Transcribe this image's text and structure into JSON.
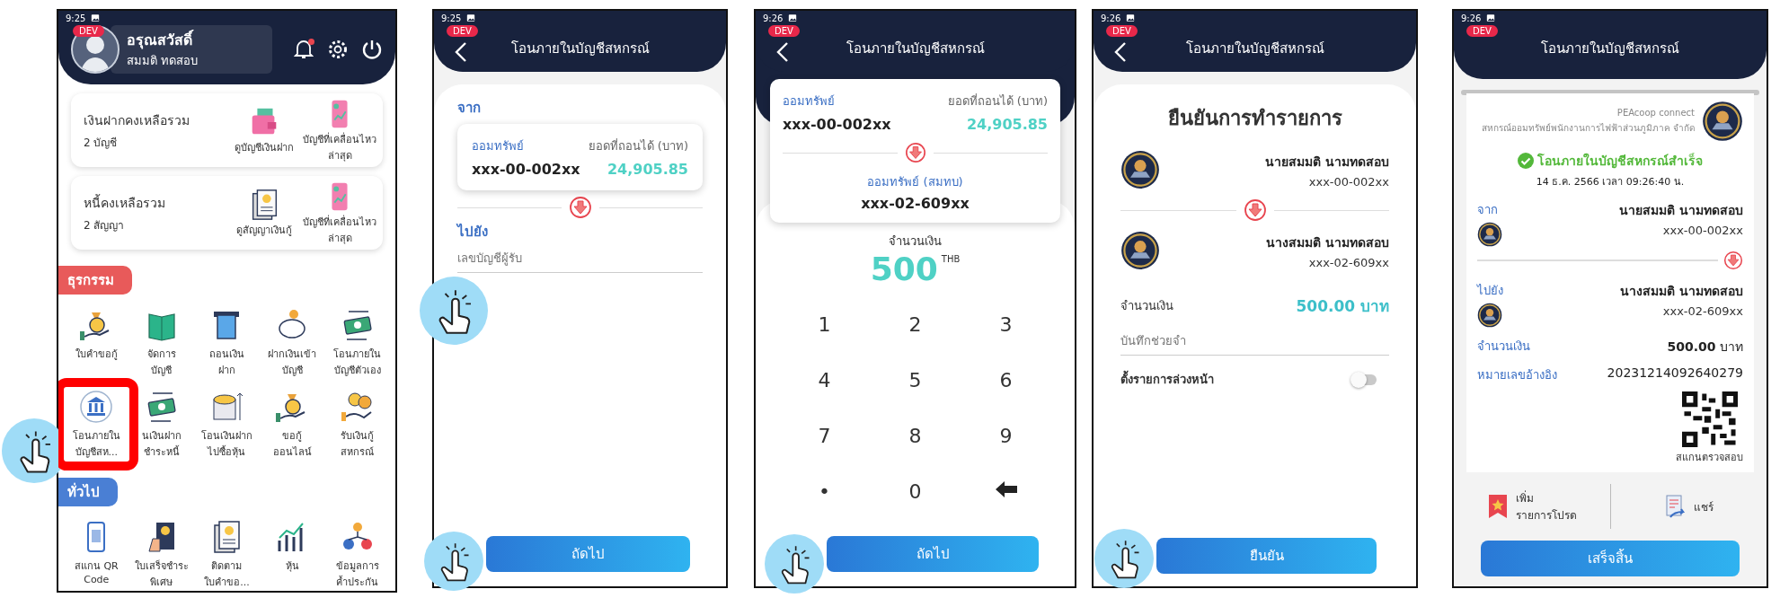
{
  "screens": [
    {
      "kind": "home",
      "status_time": "9:25",
      "env_badge": "DEV",
      "notifications_unread": true,
      "profile": {
        "greeting": "อรุณสวัสดิ์",
        "name": "สมมติ ทดสอบ"
      },
      "summary_cards": [
        {
          "title": "เงินฝากคงเหลือรวม",
          "count": "2 บัญชี",
          "actions": [
            "ดูบัญชีเงินฝาก",
            "บัญชีที่เคลื่อนไหว\nล่าสุด"
          ]
        },
        {
          "title": "หนี้คงเหลือรวม",
          "count": "2 สัญญา",
          "actions": [
            "ดูสัญญาเงินกู้",
            "บัญชีที่เคลื่อนไหว\nล่าสุด"
          ]
        }
      ],
      "sections": [
        {
          "title": "ธุรกรรม",
          "color": "#e85a5a",
          "items": [
            {
              "label": "ใบคำขอกู้",
              "highlighted": false
            },
            {
              "label": "จัดการ\nบัญชี",
              "highlighted": false
            },
            {
              "label": "ถอนเงิน\nฝาก",
              "highlighted": false
            },
            {
              "label": "ฝากเงินเข้า\nบัญชี",
              "highlighted": false
            },
            {
              "label": "โอนภายใน\nบัญชีตัวเอง",
              "highlighted": false
            },
            {
              "label": "โอนภายใน\nบัญชีสห...",
              "highlighted": true
            },
            {
              "label": "นเงินฝาก\nชำระหนี้",
              "highlighted": false
            },
            {
              "label": "โอนเงินฝาก\nไปซื้อหุ้น",
              "highlighted": false
            },
            {
              "label": "ขอกู้\nออนไลน์",
              "highlighted": false
            },
            {
              "label": "รับเงินกู้\nสหกรณ์",
              "highlighted": false
            }
          ]
        },
        {
          "title": "ทั่วไป",
          "color": "#4a7fd4",
          "items": [
            {
              "label": "สแกน QR\nCode",
              "highlighted": false
            },
            {
              "label": "ใบเสร็จชำระ\nพิเศษ",
              "highlighted": false
            },
            {
              "label": "ติดตาม\nใบคำขอ...",
              "highlighted": false
            },
            {
              "label": "หุ้น",
              "highlighted": false
            },
            {
              "label": "ข้อมูลการ\nค้ำประกัน",
              "highlighted": false
            }
          ]
        }
      ]
    },
    {
      "kind": "transfer_form",
      "status_time": "9:25",
      "env_badge": "DEV",
      "back_button": true,
      "title": "โอนภายในบัญชีสหกรณ์",
      "from_label": "จาก",
      "from_account": {
        "type": "ออมทรัพย์",
        "balance_label": "ยอดที่ถอนได้ (บาท)",
        "number": "xxx-00-002xx",
        "balance": "24,905.85"
      },
      "to_label": "ไปยัง",
      "recipient_field": {
        "placeholder": "เลขบัญชีผู้รับ"
      },
      "button": "ถัดไป"
    },
    {
      "kind": "amount_entry",
      "status_time": "9:26",
      "env_badge": "DEV",
      "back_button": true,
      "title": "โอนภายในบัญชีสหกรณ์",
      "from_account": {
        "type": "ออมทรัพย์",
        "balance_label": "ยอดที่ถอนได้ (บาท)",
        "number": "xxx-00-002xx",
        "balance": "24,905.85"
      },
      "to_account": {
        "type": "ออมทรัพย์ (สมทบ)",
        "number": "xxx-02-609xx"
      },
      "amount_label": "จำนวนเงิน",
      "amount": "500",
      "currency": "THB",
      "keys": [
        "1",
        "2",
        "3",
        "4",
        "5",
        "6",
        "7",
        "8",
        "9",
        "•",
        "0"
      ],
      "button": "ถัดไป"
    },
    {
      "kind": "confirm",
      "status_time": "9:26",
      "env_badge": "DEV",
      "back_button": true,
      "title": "โอนภายในบัญชีสหกรณ์",
      "heading": "ยืนยันการทำรายการ",
      "from": {
        "name": "นายสมมติ นามทดสอบ",
        "account": "xxx-00-002xx"
      },
      "to": {
        "name": "นางสมมติ นามทดสอบ",
        "account": "xxx-02-609xx"
      },
      "amount_label": "จำนวนเงิน",
      "amount": "500.00 บาท",
      "memo_field": {
        "placeholder": "บันทึกช่วยจำ"
      },
      "schedule": {
        "label": "ตั้งรายการล่วงหน้า",
        "on": false
      },
      "button": "ยืนยัน"
    },
    {
      "kind": "receipt",
      "status_time": "9:26",
      "env_badge": "DEV",
      "back_button": false,
      "title": "โอนภายในบัญชีสหกรณ์",
      "brand": "PEAcoop connect",
      "organization": "สหกรณ์ออมทรัพย์พนักงานการไฟฟ้าส่วนภูมิภาค จำกัด",
      "status": "โอนภายในบัญชีสหกรณ์สำเร็จ",
      "timestamp": "14 ธ.ค. 2566 เวลา 09:26:40 น.",
      "from": {
        "label": "จาก",
        "name": "นายสมมติ นามทดสอบ",
        "account": "xxx-00-002xx"
      },
      "to": {
        "label": "ไปยัง",
        "name": "นางสมมติ นามทดสอบ",
        "account": "xxx-02-609xx"
      },
      "details": [
        {
          "label": "จำนวนเงิน",
          "value": "**500.00** บาท"
        },
        {
          "label": "หมายเลขอ้างอิง",
          "value": "20231214092640279"
        }
      ],
      "qr_caption": "สแกนตรวจสอบ",
      "actions": [
        {
          "label": "เพิ่ม\nรายการโปรด"
        },
        {
          "label": "แชร์"
        }
      ],
      "button": "เสร็จสิ้น"
    }
  ]
}
